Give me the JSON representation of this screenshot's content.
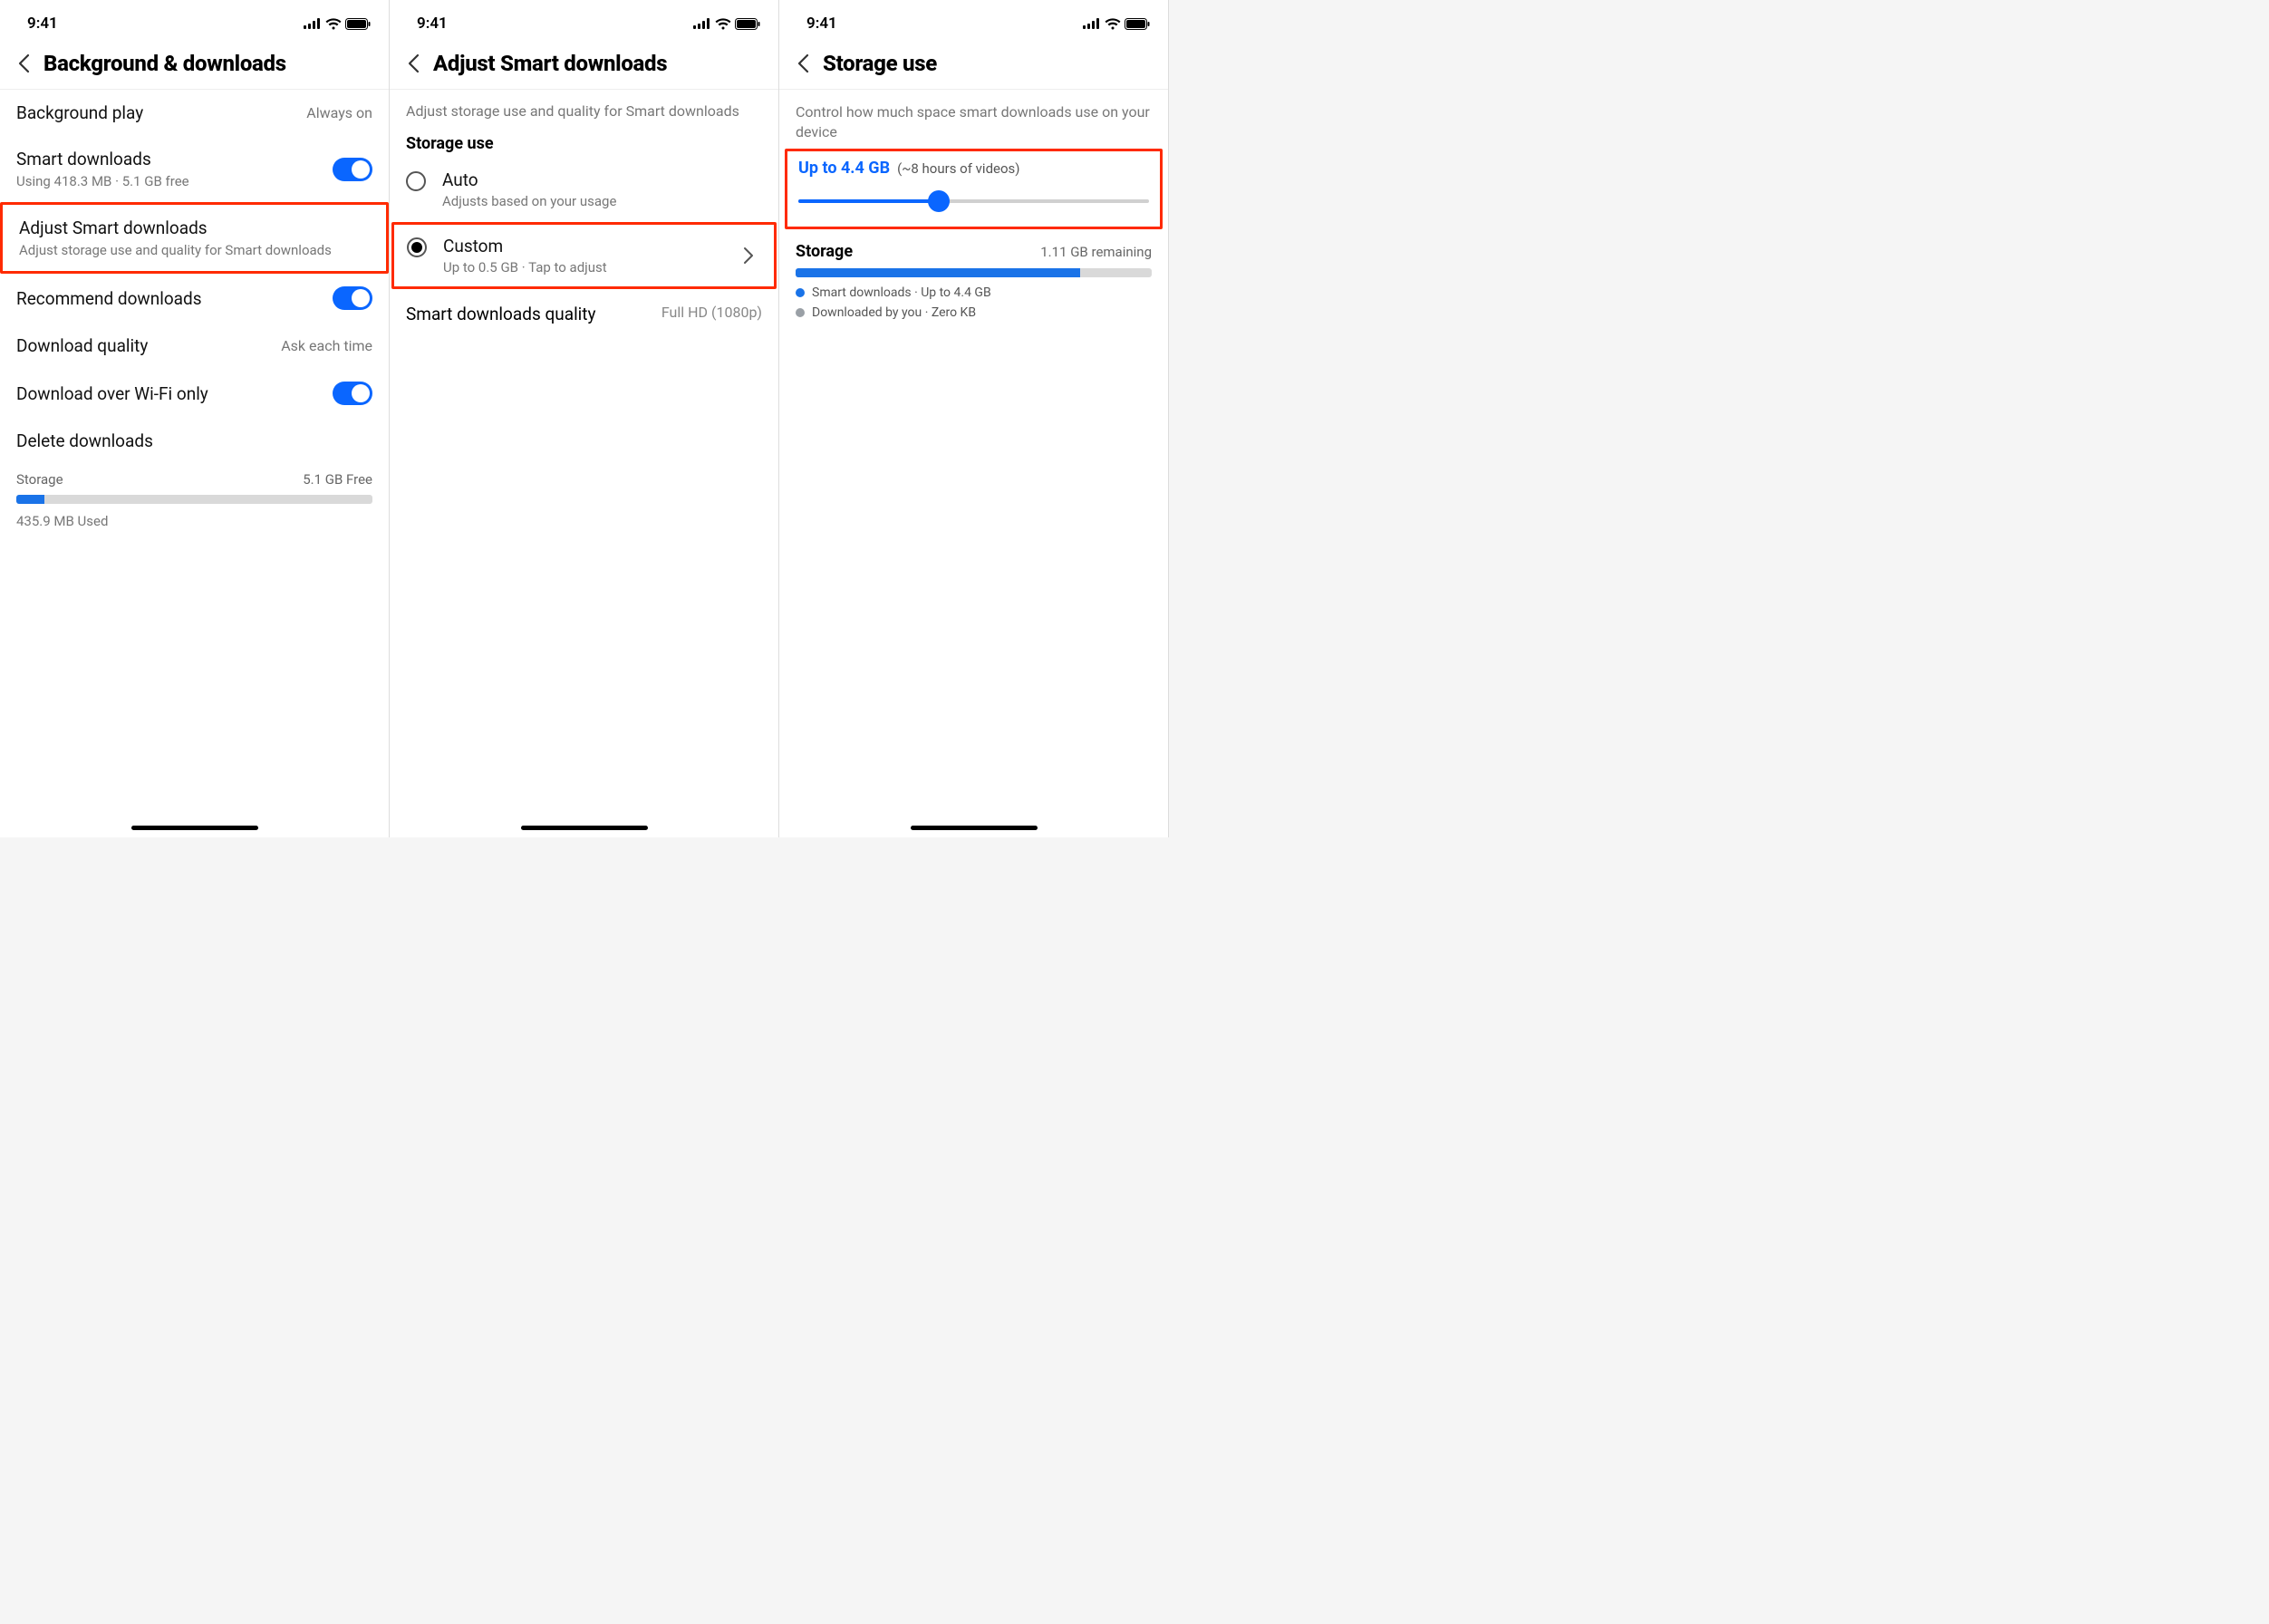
{
  "status": {
    "time": "9:41"
  },
  "screen1": {
    "title": "Background & downloads",
    "rows": {
      "bgplay": {
        "title": "Background play",
        "value": "Always on"
      },
      "smart": {
        "title": "Smart downloads",
        "sub": "Using 418.3 MB · 5.1 GB free"
      },
      "adjust": {
        "title": "Adjust Smart downloads",
        "sub": "Adjust storage use and quality for Smart downloads"
      },
      "recommend": {
        "title": "Recommend downloads"
      },
      "dlquality": {
        "title": "Download quality",
        "value": "Ask each time"
      },
      "wifi": {
        "title": "Download over Wi-Fi only"
      },
      "delete": {
        "title": "Delete downloads"
      }
    },
    "storage": {
      "label": "Storage",
      "free": "5.1 GB Free",
      "used": "435.9 MB Used",
      "pct": 8
    }
  },
  "screen2": {
    "title": "Adjust Smart downloads",
    "helper": "Adjust storage use and quality for Smart downloads",
    "section": "Storage use",
    "auto": {
      "title": "Auto",
      "sub": "Adjusts based on your usage"
    },
    "custom": {
      "title": "Custom",
      "sub": "Up to 0.5 GB · Tap to adjust"
    },
    "quality": {
      "label": "Smart downloads quality",
      "value": "Full HD (1080p)"
    }
  },
  "screen3": {
    "title": "Storage use",
    "helper": "Control how much space smart downloads use on your device",
    "upTo": "Up to 4.4 GB",
    "approx": "(~8 hours of videos)",
    "sliderPct": 40,
    "storage": {
      "label": "Storage",
      "remaining": "1.11 GB remaining",
      "pct": 80
    },
    "legend": {
      "smart": "Smart downloads · Up to 4.4 GB",
      "you": "Downloaded by you · Zero KB"
    }
  }
}
